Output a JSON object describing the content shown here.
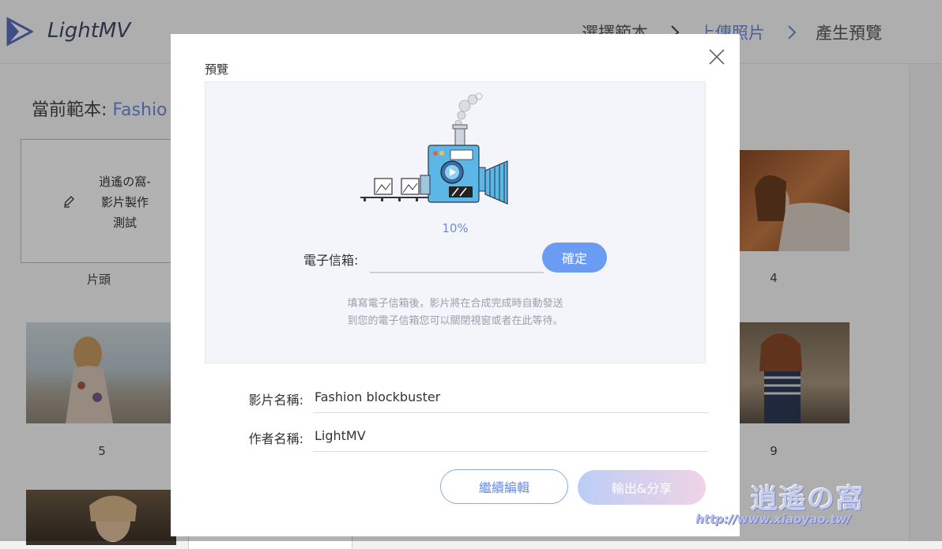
{
  "app": {
    "name": "LightMV"
  },
  "steps": [
    {
      "label": "選擇範本",
      "active": false
    },
    {
      "label": "上傳照片",
      "active": true
    },
    {
      "label": "產生預覽",
      "active": false
    }
  ],
  "template": {
    "prefix": "當前範本:",
    "name": "Fashio"
  },
  "title_card": {
    "line1": "逍遙の窩-",
    "line2": "影片製作",
    "line3": "測試",
    "label": "片頭"
  },
  "thumbnails": [
    {
      "label": "4"
    },
    {
      "label": "5"
    },
    {
      "label": "9"
    }
  ],
  "modal": {
    "title": "預覽",
    "progress": "10%",
    "email_label": "電子信箱:",
    "email_value": "",
    "confirm_label": "確定",
    "hint_line1": "填寫電子信箱後，影片將在合成完成時自動發送",
    "hint_line2": "到您的電子信箱您可以關閉視窗或者在此等待。",
    "video_name_label": "影片名稱:",
    "video_name_value": "Fashion blockbuster",
    "author_label": "作者名稱:",
    "author_value": "LightMV",
    "continue_label": "繼續編輯",
    "export_label": "輸出&分享"
  },
  "watermark": {
    "title": "逍遙の窩",
    "url": "http://www.xiaoyao.tw/"
  },
  "colors": {
    "accent": "#6b8cde",
    "button": "#6b9cf3",
    "overlay": "rgba(0,0,0,0.30)"
  }
}
